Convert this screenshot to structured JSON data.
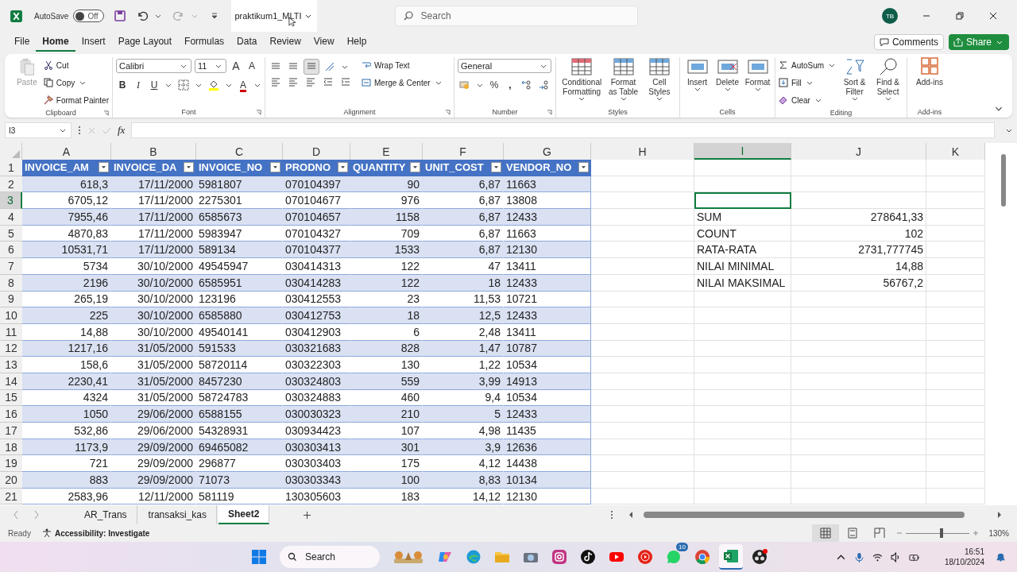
{
  "title_bar": {
    "autosave_label": "AutoSave",
    "autosave_on": false,
    "autosave_state": "Off",
    "file_name": "praktikum1_MLTI",
    "search_placeholder": "Search",
    "user_initials": "TB"
  },
  "menu_tabs": [
    {
      "label": "File",
      "selected": false
    },
    {
      "label": "Home",
      "selected": true
    },
    {
      "label": "Insert",
      "selected": false
    },
    {
      "label": "Page Layout",
      "selected": false
    },
    {
      "label": "Formulas",
      "selected": false
    },
    {
      "label": "Data",
      "selected": false
    },
    {
      "label": "Review",
      "selected": false
    },
    {
      "label": "View",
      "selected": false
    },
    {
      "label": "Help",
      "selected": false
    }
  ],
  "comments_button": "Comments",
  "share_button": "Share",
  "ribbon": {
    "clipboard": {
      "title": "Clipboard",
      "paste": "Paste",
      "cut": "Cut",
      "copy": "Copy",
      "format_painter": "Format Painter"
    },
    "font": {
      "title": "Font",
      "font_name": "Calibri",
      "font_size": "11",
      "grow": "A",
      "shrink": "A",
      "bold": "B",
      "italic": "I",
      "underline": "U",
      "font_color": "A"
    },
    "alignment": {
      "title": "Alignment",
      "wrap_text": "Wrap Text",
      "merge_center": "Merge & Center"
    },
    "number": {
      "title": "Number",
      "format": "General",
      "percent": "%",
      "comma": ","
    },
    "styles": {
      "title": "Styles",
      "items": [
        "Conditional Formatting",
        "Format as Table",
        "Cell Styles"
      ]
    },
    "cells": {
      "title": "Cells",
      "items": [
        "Insert",
        "Delete",
        "Format"
      ]
    },
    "editing": {
      "title": "Editing",
      "autosum": "AutoSum",
      "fill": "Fill",
      "clear": "Clear",
      "sort_filter": "Sort & Filter",
      "find_select": "Find & Select"
    },
    "addins": {
      "title": "Add-ins",
      "label": "Add-ins"
    }
  },
  "formula_bar": {
    "name_box": "I3",
    "fx": "fx"
  },
  "grid": {
    "columns": [
      {
        "letter": "A",
        "selected": false
      },
      {
        "letter": "B",
        "selected": false
      },
      {
        "letter": "C",
        "selected": false
      },
      {
        "letter": "D",
        "selected": false
      },
      {
        "letter": "E",
        "selected": false
      },
      {
        "letter": "F",
        "selected": false
      },
      {
        "letter": "G",
        "selected": false
      },
      {
        "letter": "H",
        "selected": false
      },
      {
        "letter": "I",
        "selected": true
      },
      {
        "letter": "J",
        "selected": false
      },
      {
        "letter": "K",
        "selected": false
      }
    ],
    "rows": [
      {
        "number": "1",
        "selected": false,
        "kind": "header",
        "cells": [
          "INVOICE_AM",
          "INVOICE_DA",
          "INVOICE_NO",
          "PRODNO",
          "QUANTITY",
          "UNIT_COST",
          "VENDOR_NO"
        ]
      },
      {
        "number": "2",
        "selected": false,
        "kind": "data",
        "cells": [
          "618,3",
          "17/11/2000",
          "5981807",
          "070104397",
          "90",
          "6,87",
          "11663"
        ]
      },
      {
        "number": "3",
        "selected": true,
        "kind": "data",
        "cells": [
          "6705,12",
          "17/11/2000",
          "2275301",
          "070104677",
          "976",
          "6,87",
          "13808"
        ]
      },
      {
        "number": "4",
        "selected": false,
        "kind": "data",
        "cells": [
          "7955,46",
          "17/11/2000",
          "6585673",
          "070104657",
          "1158",
          "6,87",
          "12433"
        ],
        "summary": [
          "SUM",
          "278641,33"
        ]
      },
      {
        "number": "5",
        "selected": false,
        "kind": "data",
        "cells": [
          "4870,83",
          "17/11/2000",
          "5983947",
          "070104327",
          "709",
          "6,87",
          "11663"
        ],
        "summary": [
          "COUNT",
          "102"
        ]
      },
      {
        "number": "6",
        "selected": false,
        "kind": "data",
        "cells": [
          "10531,71",
          "17/11/2000",
          "589134",
          "070104377",
          "1533",
          "6,87",
          "12130"
        ],
        "summary": [
          "RATA-RATA",
          "2731,777745"
        ]
      },
      {
        "number": "7",
        "selected": false,
        "kind": "data",
        "cells": [
          "5734",
          "30/10/2000",
          "49545947",
          "030414313",
          "122",
          "47",
          "13411"
        ],
        "summary": [
          "NILAI MINIMAL",
          "14,88"
        ]
      },
      {
        "number": "8",
        "selected": false,
        "kind": "data",
        "cells": [
          "2196",
          "30/10/2000",
          "6585951",
          "030414283",
          "122",
          "18",
          "12433"
        ],
        "summary": [
          "NILAI MAKSIMAL",
          "56767,2"
        ]
      },
      {
        "number": "9",
        "selected": false,
        "kind": "data",
        "cells": [
          "265,19",
          "30/10/2000",
          "123196",
          "030412553",
          "23",
          "11,53",
          "10721"
        ]
      },
      {
        "number": "10",
        "selected": false,
        "kind": "data",
        "cells": [
          "225",
          "30/10/2000",
          "6585880",
          "030412753",
          "18",
          "12,5",
          "12433"
        ]
      },
      {
        "number": "11",
        "selected": false,
        "kind": "data",
        "cells": [
          "14,88",
          "30/10/2000",
          "49540141",
          "030412903",
          "6",
          "2,48",
          "13411"
        ]
      },
      {
        "number": "12",
        "selected": false,
        "kind": "data",
        "cells": [
          "1217,16",
          "31/05/2000",
          "591533",
          "030321683",
          "828",
          "1,47",
          "10787"
        ]
      },
      {
        "number": "13",
        "selected": false,
        "kind": "data",
        "cells": [
          "158,6",
          "31/05/2000",
          "58720114",
          "030322303",
          "130",
          "1,22",
          "10534"
        ]
      },
      {
        "number": "14",
        "selected": false,
        "kind": "data",
        "cells": [
          "2230,41",
          "31/05/2000",
          "8457230",
          "030324803",
          "559",
          "3,99",
          "14913"
        ]
      },
      {
        "number": "15",
        "selected": false,
        "kind": "data",
        "cells": [
          "4324",
          "31/05/2000",
          "58724783",
          "030324883",
          "460",
          "9,4",
          "10534"
        ]
      },
      {
        "number": "16",
        "selected": false,
        "kind": "data",
        "cells": [
          "1050",
          "29/06/2000",
          "6588155",
          "030030323",
          "210",
          "5",
          "12433"
        ]
      },
      {
        "number": "17",
        "selected": false,
        "kind": "data",
        "cells": [
          "532,86",
          "29/06/2000",
          "54328931",
          "030934423",
          "107",
          "4,98",
          "11435"
        ]
      },
      {
        "number": "18",
        "selected": false,
        "kind": "data",
        "cells": [
          "1173,9",
          "29/09/2000",
          "69465082",
          "030303413",
          "301",
          "3,9",
          "12636"
        ]
      },
      {
        "number": "19",
        "selected": false,
        "kind": "data",
        "cells": [
          "721",
          "29/09/2000",
          "296877",
          "030303403",
          "175",
          "4,12",
          "14438"
        ]
      },
      {
        "number": "20",
        "selected": false,
        "kind": "data",
        "cells": [
          "883",
          "29/09/2000",
          "71073",
          "030303343",
          "100",
          "8,83",
          "10134"
        ]
      },
      {
        "number": "21",
        "selected": false,
        "kind": "data",
        "cells": [
          "2583,96",
          "12/11/2000",
          "581119",
          "130305603",
          "183",
          "14,12",
          "12130"
        ]
      }
    ]
  },
  "sheet_tabs": [
    {
      "label": "AR_Trans",
      "selected": false
    },
    {
      "label": "transaksi_kas",
      "selected": false
    },
    {
      "label": "Sheet2",
      "selected": true
    }
  ],
  "status": {
    "ready": "Ready",
    "accessibility": "Accessibility: Investigate",
    "page_views": [
      {
        "selected": true
      },
      {
        "selected": false
      },
      {
        "selected": false
      }
    ],
    "zoom": {
      "level": 0.56
    },
    "zoom_label": "130%"
  },
  "taskbar": {
    "search": "Search",
    "chat_badge": "10",
    "time": "16:51",
    "date": "18/10/2024"
  }
}
